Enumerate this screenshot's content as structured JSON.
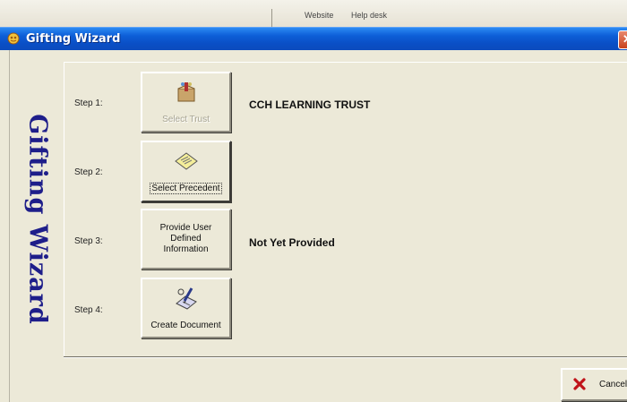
{
  "background_app": {
    "toolbar_labels": [
      "Website",
      "Help desk"
    ]
  },
  "window": {
    "title": "Gifting Wizard",
    "close_glyph": "✕"
  },
  "sidebar": {
    "title": "Gifting Wizard"
  },
  "steps": [
    {
      "label": "Step 1:",
      "button": "Select Trust",
      "status": "CCH LEARNING TRUST",
      "icon": "trust-box-icon",
      "enabled": false
    },
    {
      "label": "Step 2:",
      "button": "Select Precedent",
      "status": "",
      "icon": "document-icon",
      "enabled": true
    },
    {
      "label": "Step 3:",
      "button": "Provide User Defined Information",
      "status": "Not Yet Provided",
      "icon": "",
      "enabled": true
    },
    {
      "label": "Step 4:",
      "button": "Create Document",
      "status": "",
      "icon": "pen-document-icon",
      "enabled": true
    }
  ],
  "cancel": {
    "label": "Cancel",
    "icon": "red-x-icon"
  },
  "colors": {
    "titlebar": "#0a4fc6",
    "face": "#ece9d8",
    "sidebar_title": "#1e1e8a"
  }
}
